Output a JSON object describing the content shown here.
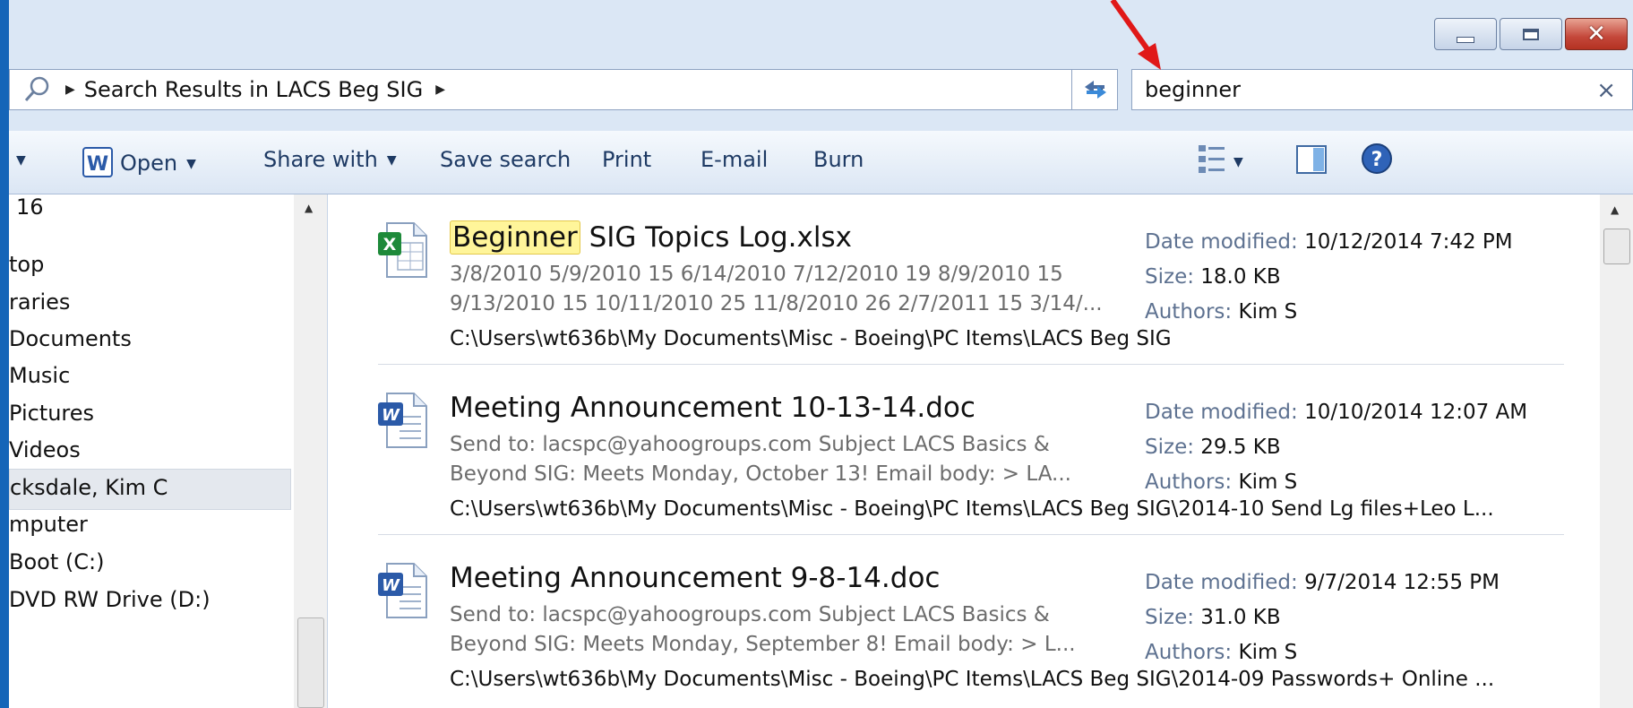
{
  "window": {
    "caption_buttons": [
      "minimize",
      "maximize",
      "close"
    ],
    "close_glyph": "✕"
  },
  "address": {
    "breadcrumb": "Search Results in LACS Beg SIG",
    "search_value": "beginner",
    "clear_glyph": "×"
  },
  "toolbar": {
    "open_label": "Open",
    "share_label": "Share with",
    "save_search_label": "Save search",
    "print_label": "Print",
    "email_label": "E-mail",
    "burn_label": "Burn"
  },
  "nav": {
    "items": [
      {
        "label": "16"
      },
      {
        "label": "top"
      },
      {
        "label": "raries"
      },
      {
        "label": "Documents"
      },
      {
        "label": "Music"
      },
      {
        "label": "Pictures"
      },
      {
        "label": "Videos"
      },
      {
        "label": "cksdale, Kim C"
      },
      {
        "label": "mputer"
      },
      {
        "label": "Boot (C:)"
      },
      {
        "label": "DVD RW Drive (D:)"
      }
    ]
  },
  "meta_labels": {
    "date_modified": "Date modified:",
    "size": "Size:",
    "authors": "Authors:"
  },
  "results": [
    {
      "type": "excel",
      "name_highlight": "Beginner",
      "name_rest": " SIG Topics Log.xlsx",
      "snippet1": "3/8/2010 5/9/2010 15 6/14/2010 7/12/2010 19 8/9/2010 15",
      "snippet2": "9/13/2010 15 10/11/2010 25 11/8/2010 26 2/7/2011 15 3/14/...",
      "date_modified": "10/12/2014 7:42 PM",
      "size": "18.0 KB",
      "authors": "Kim S",
      "path": "C:\\Users\\wt636b\\My Documents\\Misc - Boeing\\PC Items\\LACS Beg SIG"
    },
    {
      "type": "word",
      "name_highlight": "",
      "name_rest": "Meeting Announcement 10-13-14.doc",
      "snippet1": "Send to: lacspc@yahoogroups.com Subject LACS Basics &",
      "snippet2": "Beyond SIG: Meets Monday, October 13! Email body: > LA...",
      "date_modified": "10/10/2014 12:07 AM",
      "size": "29.5 KB",
      "authors": "Kim S",
      "path": "C:\\Users\\wt636b\\My Documents\\Misc - Boeing\\PC Items\\LACS Beg SIG\\2014-10 Send Lg files+Leo L..."
    },
    {
      "type": "word",
      "name_highlight": "",
      "name_rest": "Meeting Announcement 9-8-14.doc",
      "snippet1": "Send to: lacspc@yahoogroups.com Subject LACS Basics &",
      "snippet2": "Beyond SIG: Meets Monday, September 8! Email body: > L...",
      "date_modified": "9/7/2014 12:55 PM",
      "size": "31.0 KB",
      "authors": "Kim S",
      "path": "C:\\Users\\wt636b\\My Documents\\Misc - Boeing\\PC Items\\LACS Beg SIG\\2014-09 Passwords+ Online ..."
    }
  ],
  "colors": {
    "frame": "#1565b8",
    "highlight": "#fff59a",
    "annotation": "#e01818"
  }
}
